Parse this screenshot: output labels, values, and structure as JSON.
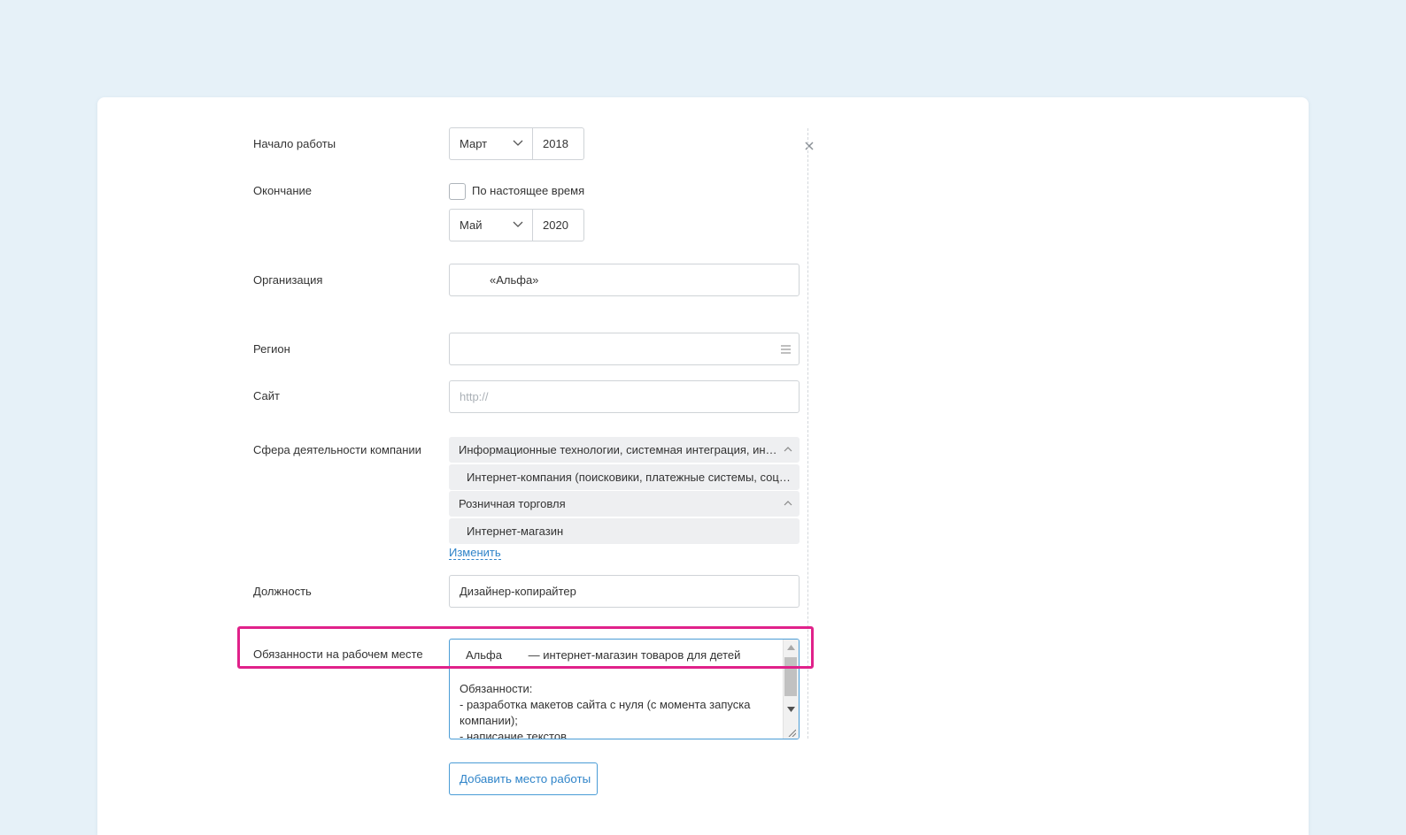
{
  "start": {
    "label": "Начало работы",
    "month": "Март",
    "year": "2018"
  },
  "end": {
    "label": "Окончание",
    "present_label": "По настоящее время",
    "month": "Май",
    "year": "2020"
  },
  "organization": {
    "label": "Организация",
    "value": "«Альфа»"
  },
  "region": {
    "label": "Регион",
    "value": ""
  },
  "site": {
    "label": "Сайт",
    "placeholder": "http://"
  },
  "sphere": {
    "label": "Сфера деятельности компании",
    "items": [
      {
        "text": "Информационные технологии, системная интеграция, инт…",
        "level": 0
      },
      {
        "text": "Интернет-компания (поисковики, платежные системы, соц…",
        "level": 1
      },
      {
        "text": "Розничная торговля",
        "level": 0
      },
      {
        "text": "Интернет-магазин",
        "level": 1
      }
    ],
    "change_link": "Изменить"
  },
  "position": {
    "label": "Должность",
    "value": "Дизайнер-копирайтер"
  },
  "duties": {
    "label": "Обязанности на рабочем месте",
    "first_word": "Альфа",
    "first_rest": "— интернет-магазин товаров для детей",
    "heading": "Обязанности:",
    "line1": "- разработка макетов сайта с нуля (с момента запуска",
    "line2": "компании);",
    "line3": "- написание текстов"
  },
  "add_button": "Добавить место работы",
  "colors": {
    "background": "#e6f1f8",
    "accent": "#2f84c9",
    "highlight": "#e0218a"
  }
}
